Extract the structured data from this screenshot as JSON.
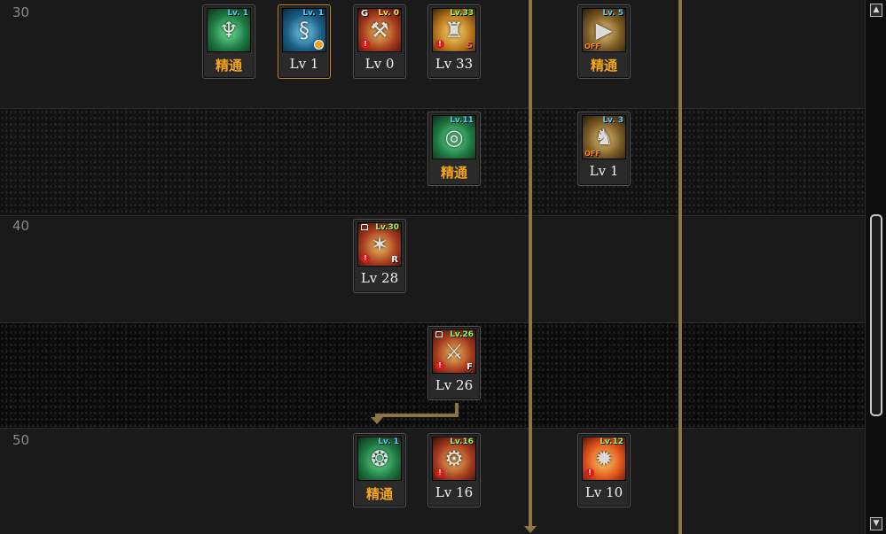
{
  "level_rows": [
    "30",
    "",
    "40",
    "",
    "50"
  ],
  "skills": [
    {
      "badge": "Lv. 1",
      "badge_color": "blue",
      "caption": "精通",
      "caption_style": "master",
      "icon": "green-dragon-skill-icon",
      "flags": []
    },
    {
      "badge": "Lv. 1",
      "badge_color": "blue",
      "caption": "Lv 1",
      "caption_style": "level",
      "icon": "blue-spirit-skill-icon",
      "flags": [
        "clock"
      ],
      "selected": true
    },
    {
      "badge": "Lv. 0",
      "badge_color": "yellow",
      "caption": "Lv 0",
      "caption_style": "level",
      "icon": "red-weapon-skill-icon",
      "flags": [
        "G",
        "alert"
      ],
      "g_text": "G"
    },
    {
      "badge": "Lv.33",
      "badge_color": "green",
      "caption": "Lv 33",
      "caption_style": "level",
      "icon": "yellow-robot-skill-icon",
      "flags": [
        "alert",
        "S"
      ],
      "letter": "S"
    },
    {
      "badge": "Lv. 5",
      "badge_color": "blue",
      "caption": "精通",
      "caption_style": "master",
      "icon": "gold-play-skill-icon",
      "flags": [
        "OFF"
      ],
      "off_text": "OFF"
    },
    {
      "badge": "Lv.11",
      "badge_color": "blue",
      "caption": "精通",
      "caption_style": "master",
      "icon": "green-vortex-skill-icon",
      "flags": []
    },
    {
      "badge": "Lv. 3",
      "badge_color": "blue",
      "caption": "Lv 1",
      "caption_style": "level",
      "icon": "gold-mech-skill-icon",
      "flags": [
        "OFF"
      ],
      "off_text": "OFF"
    },
    {
      "badge": "Lv.30",
      "badge_color": "green",
      "caption": "Lv 28",
      "caption_style": "level",
      "icon": "red-blast-skill-icon",
      "flags": [
        "lock",
        "alert",
        "R"
      ],
      "letter": "R"
    },
    {
      "badge": "Lv.26",
      "badge_color": "green",
      "caption": "Lv 26",
      "caption_style": "level",
      "icon": "red-cannon-skill-icon",
      "flags": [
        "lock",
        "alert",
        "F"
      ],
      "letter": "F"
    },
    {
      "badge": "Lv. 1",
      "badge_color": "blue",
      "caption": "精通",
      "caption_style": "master",
      "icon": "green-wind-skill-icon",
      "flags": []
    },
    {
      "badge": "Lv.16",
      "badge_color": "green",
      "caption": "Lv 16",
      "caption_style": "level",
      "icon": "red-gear-skill-icon",
      "flags": [
        "alert"
      ]
    },
    {
      "badge": "Lv.12",
      "badge_color": "green",
      "caption": "Lv 10",
      "caption_style": "level",
      "icon": "orange-burst-skill-icon",
      "flags": [
        "alert"
      ]
    }
  ],
  "scrollbar": {
    "up": "▲",
    "down": "▼"
  }
}
